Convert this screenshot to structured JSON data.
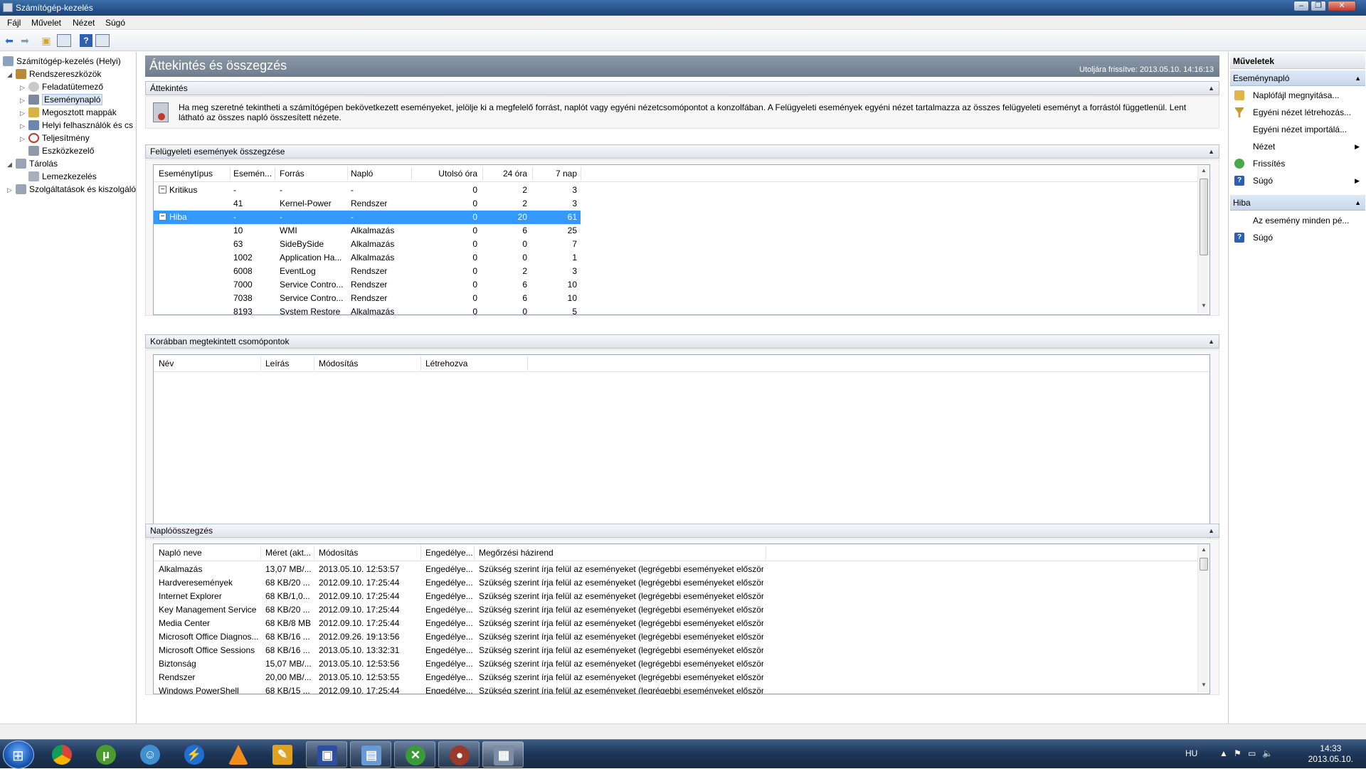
{
  "window": {
    "title": "Számítógép-kezelés"
  },
  "menu": [
    "Fájl",
    "Művelet",
    "Nézet",
    "Súgó"
  ],
  "tree": {
    "root": "Számítógép-kezelés (Helyi)",
    "items": [
      {
        "label": "Rendszereszközök"
      },
      {
        "label": "Feladatütemező"
      },
      {
        "label": "Eseménynapló"
      },
      {
        "label": "Megosztott mappák"
      },
      {
        "label": "Helyi felhasználók és cs"
      },
      {
        "label": "Teljesítmény"
      },
      {
        "label": "Eszközkezelő"
      },
      {
        "label": "Tárolás"
      },
      {
        "label": "Lemezkezelés"
      },
      {
        "label": "Szolgáltatások és kiszolgáló"
      }
    ]
  },
  "main": {
    "title": "Áttekintés és összegzés",
    "refreshed": "Utoljára frissítve: 2013.05.10. 14:16:13",
    "overview": {
      "header": "Áttekintés",
      "text": "Ha meg szeretné tekintheti a számítógépen bekövetkezett eseményeket, jelölje ki a megfelelő forrást, naplót vagy egyéni nézetcsomópontot a konzolfában. A Felügyeleti események egyéni nézet tartalmazza az összes felügyeleti eseményt a forrástól függetlenül. Lent látható az összes napló összesített nézete."
    },
    "admin": {
      "header": "Felügyeleti események összegzése",
      "columns": [
        "Eseménytípus",
        "Esemén...",
        "Forrás",
        "Napló",
        "Utolsó óra",
        "24 óra",
        "7 nap"
      ],
      "rows": [
        {
          "type": "Kritikus",
          "id": "-",
          "source": "-",
          "log": "-",
          "hour": "0",
          "day": "2",
          "week": "3",
          "group": true
        },
        {
          "type": "",
          "id": "41",
          "source": "Kernel-Power",
          "log": "Rendszer",
          "hour": "0",
          "day": "2",
          "week": "3"
        },
        {
          "type": "Hiba",
          "id": "-",
          "source": "-",
          "log": "-",
          "hour": "0",
          "day": "20",
          "week": "61",
          "group": true,
          "selected": true
        },
        {
          "type": "",
          "id": "10",
          "source": "WMI",
          "log": "Alkalmazás",
          "hour": "0",
          "day": "6",
          "week": "25"
        },
        {
          "type": "",
          "id": "63",
          "source": "SideBySide",
          "log": "Alkalmazás",
          "hour": "0",
          "day": "0",
          "week": "7"
        },
        {
          "type": "",
          "id": "1002",
          "source": "Application Ha...",
          "log": "Alkalmazás",
          "hour": "0",
          "day": "0",
          "week": "1"
        },
        {
          "type": "",
          "id": "6008",
          "source": "EventLog",
          "log": "Rendszer",
          "hour": "0",
          "day": "2",
          "week": "3"
        },
        {
          "type": "",
          "id": "7000",
          "source": "Service Contro...",
          "log": "Rendszer",
          "hour": "0",
          "day": "6",
          "week": "10"
        },
        {
          "type": "",
          "id": "7038",
          "source": "Service Contro...",
          "log": "Rendszer",
          "hour": "0",
          "day": "6",
          "week": "10"
        },
        {
          "type": "",
          "id": "8193",
          "source": "System Restore",
          "log": "Alkalmazás",
          "hour": "0",
          "day": "0",
          "week": "5"
        }
      ]
    },
    "recent": {
      "header": "Korábban megtekintett csomópontok",
      "columns": [
        "Név",
        "Leírás",
        "Módosítás",
        "Létrehozva"
      ]
    },
    "logsummary": {
      "header": "Naplóösszegzés",
      "columns": [
        "Napló neve",
        "Méret (akt...",
        "Módosítás",
        "Engedélye...",
        "Megőrzési házirend"
      ],
      "rows": [
        {
          "name": "Alkalmazás",
          "size": "13,07 MB/...",
          "modified": "2013.05.10. 12:53:57",
          "enabled": "Engedélye...",
          "policy": "Szükség szerint írja felül az eseményeket (legrégebbi eseményeket először)"
        },
        {
          "name": "Hardveresemények",
          "size": "68 KB/20 ...",
          "modified": "2012.09.10. 17:25:44",
          "enabled": "Engedélye...",
          "policy": "Szükség szerint írja felül az eseményeket (legrégebbi eseményeket először)"
        },
        {
          "name": "Internet Explorer",
          "size": "68 KB/1,0...",
          "modified": "2012.09.10. 17:25:44",
          "enabled": "Engedélye...",
          "policy": "Szükség szerint írja felül az eseményeket (legrégebbi eseményeket először)"
        },
        {
          "name": "Key Management Service",
          "size": "68 KB/20 ...",
          "modified": "2012.09.10. 17:25:44",
          "enabled": "Engedélye...",
          "policy": "Szükség szerint írja felül az eseményeket (legrégebbi eseményeket először)"
        },
        {
          "name": "Media Center",
          "size": "68 KB/8 MB",
          "modified": "2012.09.10. 17:25:44",
          "enabled": "Engedélye...",
          "policy": "Szükség szerint írja felül az eseményeket (legrégebbi eseményeket először)"
        },
        {
          "name": "Microsoft Office Diagnos...",
          "size": "68 KB/16 ...",
          "modified": "2012.09.26. 19:13:56",
          "enabled": "Engedélye...",
          "policy": "Szükség szerint írja felül az eseményeket (legrégebbi eseményeket először)"
        },
        {
          "name": "Microsoft Office Sessions",
          "size": "68 KB/16 ...",
          "modified": "2013.05.10. 13:32:31",
          "enabled": "Engedélye...",
          "policy": "Szükség szerint írja felül az eseményeket (legrégebbi eseményeket először)"
        },
        {
          "name": "Biztonság",
          "size": "15,07 MB/...",
          "modified": "2013.05.10. 12:53:56",
          "enabled": "Engedélye...",
          "policy": "Szükség szerint írja felül az eseményeket (legrégebbi eseményeket először)"
        },
        {
          "name": "Rendszer",
          "size": "20,00 MB/...",
          "modified": "2013.05.10. 12:53:55",
          "enabled": "Engedélye...",
          "policy": "Szükség szerint írja felül az eseményeket (legrégebbi eseményeket először)"
        },
        {
          "name": "Windows PowerShell",
          "size": "68 KB/15 ...",
          "modified": "2012.09.10. 17:25:44",
          "enabled": "Engedélye...",
          "policy": "Szükség szerint írja felül az eseményeket (legrégebbi eseményeket először)"
        }
      ]
    }
  },
  "actions": {
    "header": "Műveletek",
    "sections": [
      {
        "title": "Eseménynapló",
        "items": [
          {
            "label": "Naplófájl megnyitása...",
            "icon": "folder-icon"
          },
          {
            "label": "Egyéni nézet létrehozás...",
            "icon": "filter-icon"
          },
          {
            "label": "Egyéni nézet importálá...",
            "icon": ""
          },
          {
            "label": "Nézet",
            "icon": "",
            "submenu": true
          },
          {
            "label": "Frissítés",
            "icon": "refresh-icon"
          },
          {
            "label": "Súgó",
            "icon": "help-icon",
            "submenu": true
          }
        ]
      },
      {
        "title": "Hiba",
        "items": [
          {
            "label": "Az esemény minden pé...",
            "icon": ""
          },
          {
            "label": "Súgó",
            "icon": "help-icon"
          }
        ]
      }
    ]
  },
  "taskbar": {
    "apps": [
      "start-button",
      "chrome",
      "utorrent",
      "messenger",
      "flash-app",
      "vlc",
      "notepad",
      "save-app",
      "remote-desktop",
      "xbox-app",
      "media-app",
      "computer-management"
    ],
    "lang": "HU",
    "time": "14:33",
    "date": "2013.05.10."
  }
}
